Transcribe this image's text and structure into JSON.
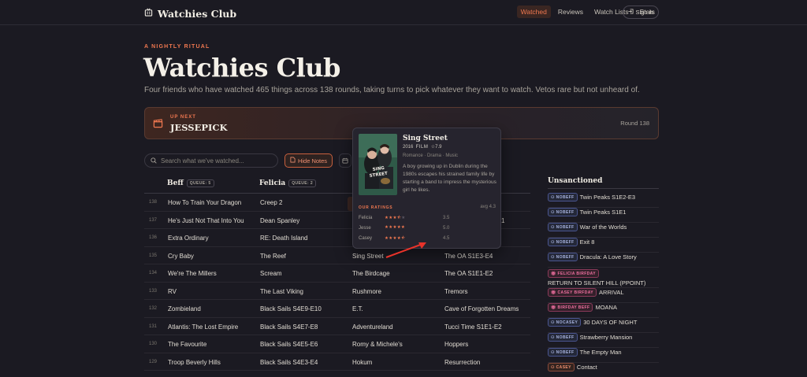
{
  "nav": {
    "brand": "Watchies Club",
    "links": [
      "Watched",
      "Reviews",
      "Watch Lists",
      "Stats"
    ],
    "sign_in": "Sign in"
  },
  "hero": {
    "eyebrow": "A NIGHTLY RITUAL",
    "title": "Watchies Club",
    "description": "Four friends who have watched 465 things across 138 rounds, taking turns to pick whatever they want to watch. Vetos rare but not unheard of."
  },
  "up_next": {
    "label": "UP NEXT",
    "name": "JESSEPICK",
    "round": "Round 138"
  },
  "toolbar": {
    "search_placeholder": "Search what we've watched...",
    "hide_notes": "Hide Notes"
  },
  "table": {
    "columns": [
      {
        "name": "Beff",
        "queue": "QUEUE: 5"
      },
      {
        "name": "Felicia",
        "queue": "QUEUE: 2"
      }
    ],
    "rows": [
      {
        "round": "138",
        "c1": "How To Train Your Dragon",
        "c2": "Creep 2",
        "c3": "",
        "c4": ""
      },
      {
        "round": "137",
        "c1": "He's Just Not That Into You",
        "c2": "Dean Spanley",
        "c3": "",
        "c4": "1"
      },
      {
        "round": "136",
        "c1": "Extra Ordinary",
        "c2": "RE: Death Island",
        "c3": "",
        "c4": ""
      },
      {
        "round": "135",
        "c1": "Cry Baby",
        "c2": "The Reef",
        "c3": "Sing Street",
        "c4": "The OA S1E3-E4"
      },
      {
        "round": "134",
        "c1": "We're The Millers",
        "c2": "Scream",
        "c3": "The Birdcage",
        "c4": "The OA S1E1-E2"
      },
      {
        "round": "133",
        "c1": "RV",
        "c2": "The Last Viking",
        "c3": "Rushmore",
        "c4": "Tremors"
      },
      {
        "round": "132",
        "c1": "Zombieland",
        "c2": "Black Sails S4E9-E10",
        "c3": "E.T.",
        "c4": "Cave of Forgotten Dreams"
      },
      {
        "round": "131",
        "c1": "Atlantis: The Lost Empire",
        "c2": "Black Sails S4E7-E8",
        "c3": "Adventureland",
        "c4": "Tucci Time S1E1-E2"
      },
      {
        "round": "130",
        "c1": "The Favourite",
        "c2": "Black Sails S4E5-E6",
        "c3": "Romy & Michele's",
        "c4": "Hoppers"
      },
      {
        "round": "129",
        "c1": "Troop Beverly Hills",
        "c2": "Black Sails S4E3-E4",
        "c3": "Hokum",
        "c4": "Resurrection"
      }
    ]
  },
  "sidebar": {
    "title": "Unsanctioned",
    "items": [
      {
        "tag": "NOBEFF",
        "color": "blue",
        "title": "Twin Peaks S1E2-E3"
      },
      {
        "tag": "NOBEFF",
        "color": "blue",
        "title": "Twin Peaks S1E1"
      },
      {
        "tag": "NOBEFF",
        "color": "blue",
        "title": "War of the Worlds"
      },
      {
        "tag": "NOBEFF",
        "color": "blue",
        "title": "Exit 8"
      },
      {
        "tag": "NOBEFF",
        "color": "blue",
        "title": "Dracula: A Love Story"
      },
      {
        "tag": "FELICIA BIRFDAY",
        "color": "pink",
        "title": "RETURN TO SILENT HILL (PPOINT)"
      },
      {
        "tag": "CASEY BIRFDAY",
        "color": "pink",
        "title": "ARRIVAL"
      },
      {
        "tag": "BIRFDAY BEFF",
        "color": "pink",
        "title": "MOANA"
      },
      {
        "tag": "NOCASEY",
        "color": "blue",
        "title": "30 DAYS OF NIGHT"
      },
      {
        "tag": "NOBEFF",
        "color": "blue",
        "title": "Strawberry Mansion"
      },
      {
        "tag": "NOBEFF",
        "color": "blue",
        "title": "The Empty Man"
      },
      {
        "tag": "CASEY",
        "color": "orange",
        "title": "Contact"
      }
    ]
  },
  "popover": {
    "title": "Sing Street",
    "year": "2016",
    "type": "FILM",
    "score": "7.9",
    "genres": "Romance · Drama · Music",
    "description": "A boy growing up in Dublin during the 1980s escapes his strained family life by starting a band to impress the mysterious girl he likes.",
    "ratings_label": "OUR RATINGS",
    "average": "avg 4.3",
    "ratings": [
      {
        "name": "Felicia",
        "stars": 3.5,
        "score": "3.5"
      },
      {
        "name": "Jesse",
        "stars": 5,
        "score": "5.0"
      },
      {
        "name": "Casey",
        "stars": 4.5,
        "score": "4.5"
      }
    ],
    "poster_text": "SING STREET"
  },
  "colors": {
    "accent": "#f07850",
    "background": "#1b1a22",
    "panel": "#26242e"
  }
}
